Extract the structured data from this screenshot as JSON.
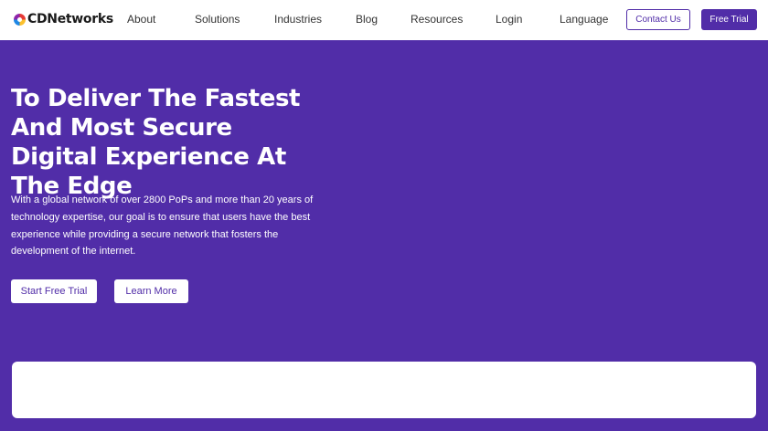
{
  "brand": {
    "name": "CDNetworks"
  },
  "nav": {
    "items": [
      "About",
      "Solutions",
      "Industries",
      "Blog",
      "Resources",
      "Login",
      "Language"
    ],
    "contact_label": "Contact Us",
    "free_trial_label": "Free Trial"
  },
  "hero": {
    "title": "To Deliver The Fastest And Most Secure Digital Experience At The Edge",
    "description": "With a global network of over 2800 PoPs and more than 20 years of technology expertise, our goal is to ensure that users have the best experience while providing a secure network that fosters the development of the internet.",
    "primary_cta": "Start Free Trial",
    "secondary_cta": "Learn More"
  },
  "colors": {
    "brand_purple": "#512da8",
    "white": "#ffffff"
  }
}
